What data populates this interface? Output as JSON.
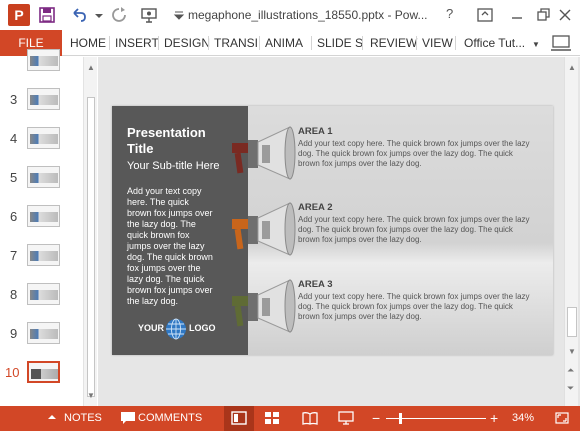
{
  "titlebar": {
    "app_letter": "P",
    "doc_title": "megaphone_illustrations_18550.pptx - Pow...",
    "help": "?"
  },
  "ribbon": {
    "file": "FILE",
    "tabs": [
      "HOME",
      "INSERT",
      "DESIGN",
      "TRANSI",
      "ANIMA",
      "SLIDE S",
      "REVIEW",
      "VIEW"
    ],
    "account": "Office Tut..."
  },
  "thumbnails": [
    {
      "num": ""
    },
    {
      "num": "3"
    },
    {
      "num": "4"
    },
    {
      "num": "5"
    },
    {
      "num": "6"
    },
    {
      "num": "7"
    },
    {
      "num": "8"
    },
    {
      "num": "9"
    },
    {
      "num": "10"
    }
  ],
  "slide": {
    "title": "Presentation Title",
    "subtitle": "Your Sub-title Here",
    "body": "Add your text copy here. The quick brown fox jumps over the lazy dog. The quick brown fox jumps over the lazy dog. The quick brown fox jumps over the lazy dog. The quick brown fox jumps over the lazy dog.",
    "logo_left": "YOUR",
    "logo_right": "LOGO",
    "areas": [
      {
        "title": "AREA 1",
        "text": "Add your text copy here. The quick brown fox jumps over the lazy dog. The quick brown fox jumps over the lazy dog. The quick brown fox jumps over the lazy dog.",
        "color": "#7a2a22"
      },
      {
        "title": "AREA 2",
        "text": "Add your text copy here. The quick brown fox jumps over the lazy dog. The quick brown fox jumps over the lazy dog. The quick brown fox jumps over the lazy dog.",
        "color": "#c8651b"
      },
      {
        "title": "AREA 3",
        "text": "Add your text copy here. The quick brown fox jumps over the lazy dog. The quick brown fox jumps over the lazy dog. The quick brown fox jumps over the lazy dog.",
        "color": "#5f6b35"
      }
    ]
  },
  "statusbar": {
    "notes": "NOTES",
    "comments": "COMMENTS",
    "zoom_minus": "−",
    "zoom_plus": "+",
    "zoom": "34%"
  },
  "colors": {
    "accent": "#d24726",
    "panel": "#585858"
  }
}
